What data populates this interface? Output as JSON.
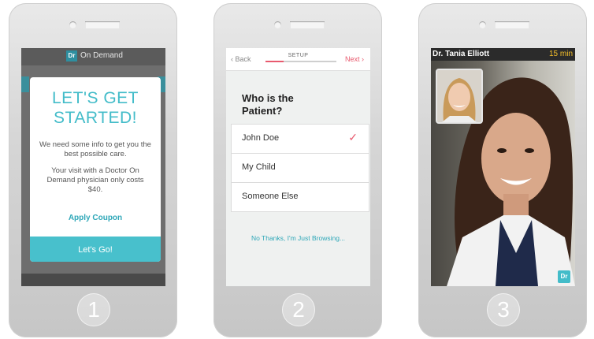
{
  "screens": {
    "one": {
      "step": "1",
      "app_title": "On Demand",
      "logo_text": "Dr",
      "modal": {
        "heading_line1": "LET'S GET",
        "heading_line2": "STARTED!",
        "info": "We need some info to get you the best possible care.",
        "price": "Your visit with a Doctor On Demand physician only costs $40.",
        "coupon_label": "Apply Coupon",
        "go_label": "Let's Go!"
      }
    },
    "two": {
      "step": "2",
      "back_label": "Back",
      "setup_label": "SETUP",
      "next_label": "Next",
      "progress_fraction": 0.25,
      "question": "Who is the Patient?",
      "options": [
        "John Doe",
        "My Child",
        "Someone Else"
      ],
      "selected_option": "John Doe",
      "browse_label": "No Thanks, I'm Just Browsing..."
    },
    "three": {
      "step": "3",
      "doctor_name": "Dr. Tania Elliott",
      "call_time": "15 min",
      "badge_text": "Dr"
    }
  },
  "colors": {
    "teal": "#43bcc9",
    "pink": "#e85a6e",
    "timer": "#f6c02a"
  },
  "icons": [
    "chevron-left-icon",
    "chevron-right-icon",
    "check-icon"
  ]
}
